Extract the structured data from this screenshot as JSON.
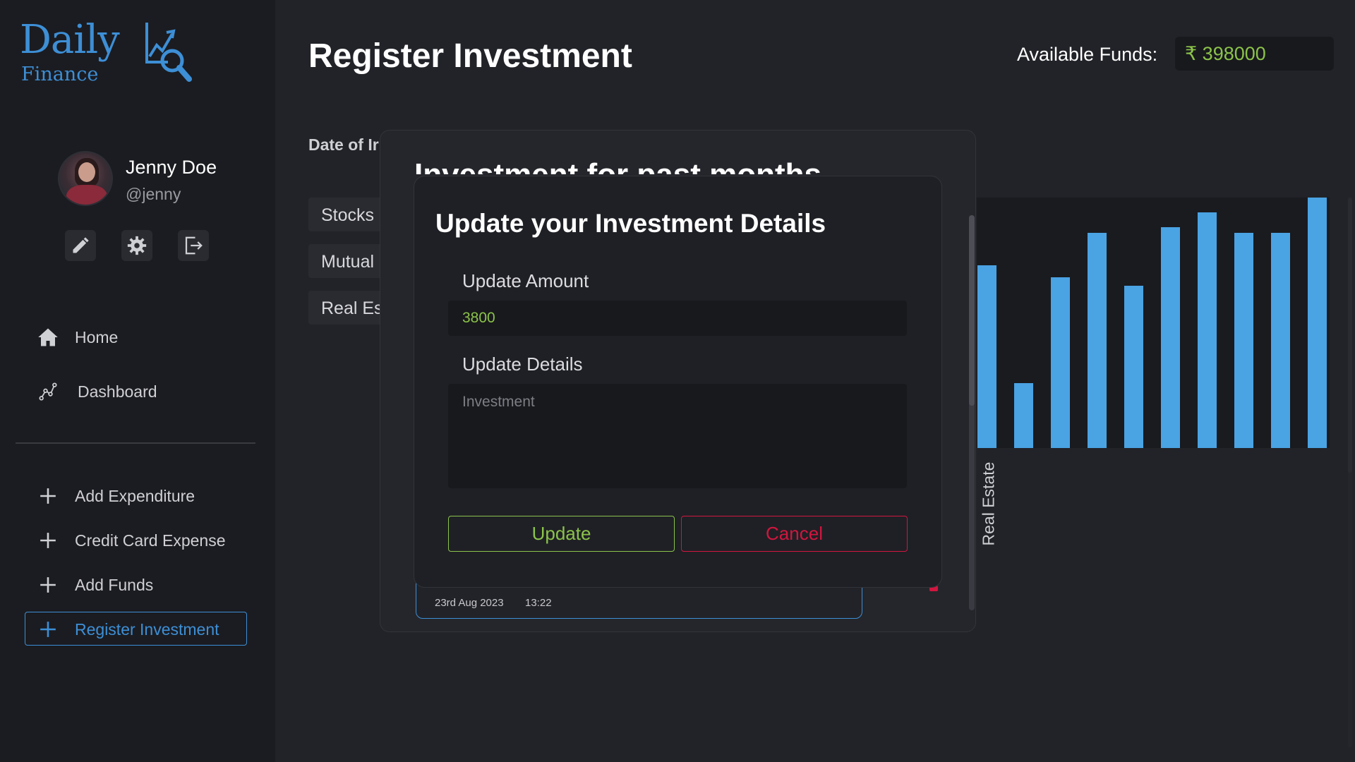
{
  "brand": {
    "name_top": "Daily",
    "name_bottom": "Finance",
    "color": "#3d8fd6"
  },
  "user": {
    "name": "Jenny Doe",
    "handle": "@jenny"
  },
  "profile_actions": [
    {
      "icon": "pencil-icon",
      "label": "edit"
    },
    {
      "icon": "gear-icon",
      "label": "settings"
    },
    {
      "icon": "logout-icon",
      "label": "logout"
    }
  ],
  "nav": {
    "home": "Home",
    "dashboard": "Dashboard",
    "add_expenditure": "Add Expenditure",
    "credit_card_expense": "Credit Card Expense",
    "add_funds": "Add Funds",
    "register_investment": "Register Investment"
  },
  "header": {
    "title": "Register Investment",
    "funds_label": "Available Funds:",
    "funds_value": "₹ 398000"
  },
  "form": {
    "date_label": "Date of Ir",
    "types": [
      "Stocks",
      "Mutual",
      "Real Es"
    ]
  },
  "outer_modal": {
    "title": "Investment for past months",
    "entry": {
      "date": "23rd Aug 2023",
      "time": "13:22"
    }
  },
  "dialog": {
    "title": "Update your Investment Details",
    "amount_label": "Update Amount",
    "amount_value": "3800",
    "details_label": "Update Details",
    "details_placeholder": "Investment",
    "update_button": "Update",
    "cancel_button": "Cancel"
  },
  "chart_data": {
    "type": "bar",
    "x_label_visible": "Real Estate",
    "values": [
      62,
      22,
      58,
      73,
      55,
      75,
      80,
      73,
      73,
      85
    ],
    "ylim": [
      0,
      85
    ],
    "bar_color": "#4aa3e3"
  },
  "colors": {
    "accent": "#3d8fd6",
    "positive": "#8bc34a",
    "danger": "#d1163f",
    "background": "#222328"
  }
}
